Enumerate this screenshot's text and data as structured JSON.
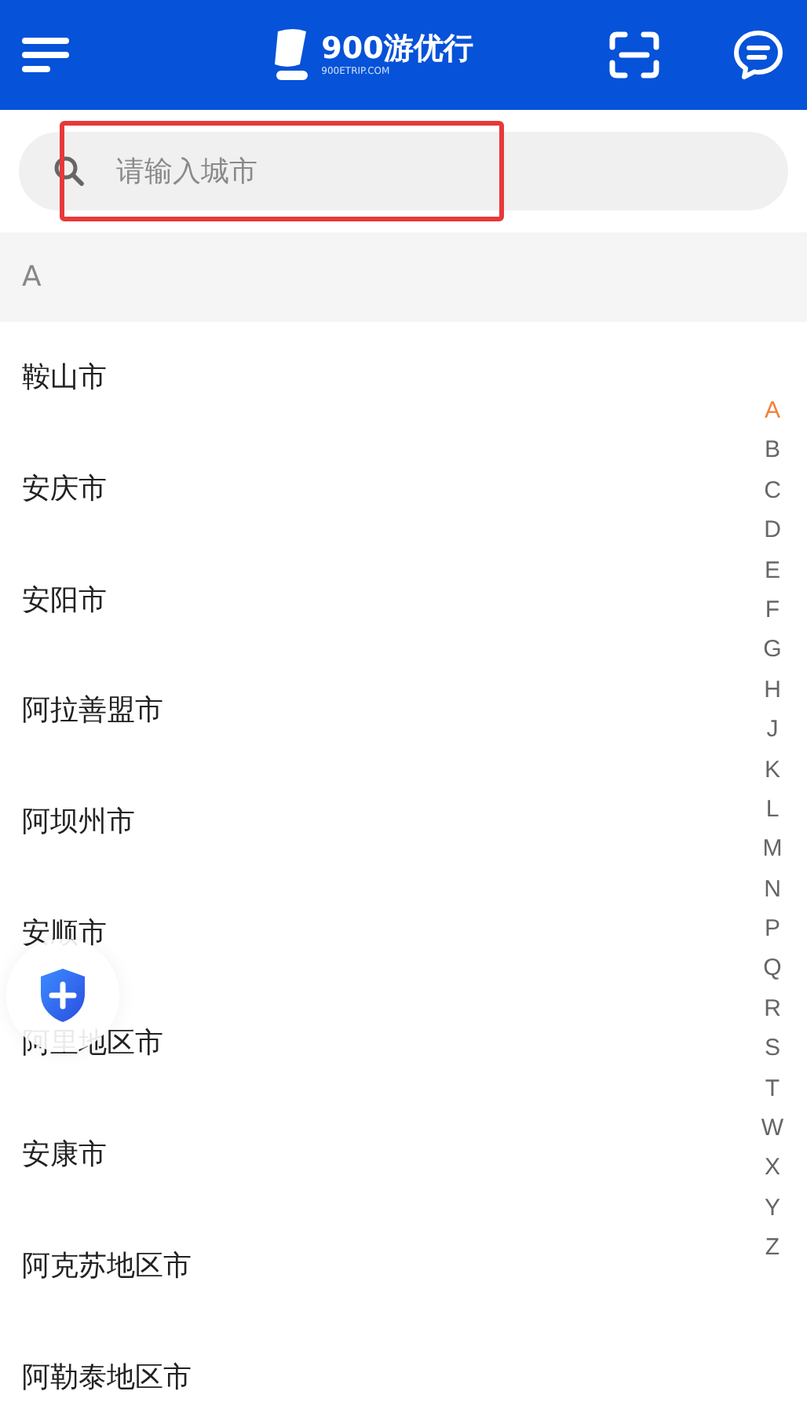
{
  "header": {
    "brand": "900游优行",
    "domain": "900ETRIP.COM"
  },
  "search": {
    "placeholder": "请输入城市"
  },
  "section": {
    "letter": "A"
  },
  "cities": [
    "鞍山市",
    "安庆市",
    "安阳市",
    "阿拉善盟市",
    "阿坝州市",
    "安顺市",
    "阿里地区市",
    "安康市",
    "阿克苏地区市",
    "阿勒泰地区市"
  ],
  "index": [
    {
      "letter": "A",
      "selected": true
    },
    {
      "letter": "B",
      "selected": false
    },
    {
      "letter": "C",
      "selected": false
    },
    {
      "letter": "D",
      "selected": false
    },
    {
      "letter": "E",
      "selected": false
    },
    {
      "letter": "F",
      "selected": false
    },
    {
      "letter": "G",
      "selected": false
    },
    {
      "letter": "H",
      "selected": false
    },
    {
      "letter": "J",
      "selected": false
    },
    {
      "letter": "K",
      "selected": false
    },
    {
      "letter": "L",
      "selected": false
    },
    {
      "letter": "M",
      "selected": false
    },
    {
      "letter": "N",
      "selected": false
    },
    {
      "letter": "P",
      "selected": false
    },
    {
      "letter": "Q",
      "selected": false
    },
    {
      "letter": "R",
      "selected": false
    },
    {
      "letter": "S",
      "selected": false
    },
    {
      "letter": "T",
      "selected": false
    },
    {
      "letter": "W",
      "selected": false
    },
    {
      "letter": "X",
      "selected": false
    },
    {
      "letter": "Y",
      "selected": false
    },
    {
      "letter": "Z",
      "selected": false
    }
  ]
}
